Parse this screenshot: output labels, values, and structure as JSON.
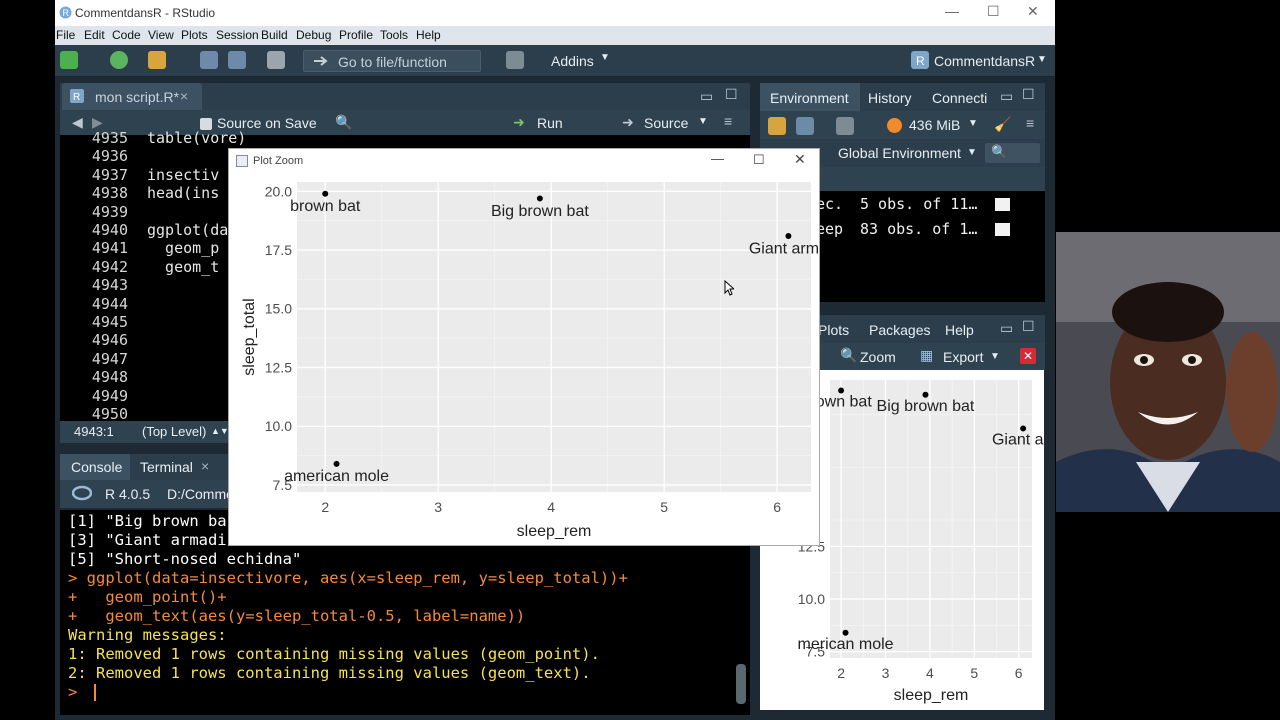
{
  "app": {
    "title": "CommentdansR - RStudio",
    "project": "CommentdansR"
  },
  "menu": [
    "File",
    "Edit",
    "Code",
    "View",
    "Plots",
    "Session",
    "Build",
    "Debug",
    "Profile",
    "Tools",
    "Help"
  ],
  "toolbar": {
    "goto_placeholder": "Go to file/function",
    "addins": "Addins"
  },
  "editor": {
    "tab_label": "mon script.R*",
    "source_on_save": "Source on Save",
    "run_label": "Run",
    "source_label": "Source",
    "line_numbers": [
      "4935",
      "4936",
      "4937",
      "4938",
      "4939",
      "4940",
      "4941",
      "4942",
      "4943",
      "4944",
      "4945",
      "4946",
      "4947",
      "4948",
      "4949",
      "4950"
    ],
    "code_lines": [
      "table(vore)",
      "",
      "insectiv",
      "head(ins",
      "",
      "ggplot(da",
      "  geom_p",
      "  geom_t",
      "",
      "",
      "",
      "",
      "",
      "",
      "",
      ""
    ],
    "status_position": "4943:1",
    "status_scope": "(Top Level)"
  },
  "environment": {
    "tabs": [
      "Environment",
      "History",
      "Connecti"
    ],
    "memory": "436 MiB",
    "scope": "Global Environment",
    "rows": [
      {
        "name": "ec.",
        "value": "5 obs. of 11…"
      },
      {
        "name": "eep",
        "value": "83 obs. of 1…"
      }
    ]
  },
  "files": {
    "tabs": [
      "Plots",
      "Packages",
      "Help"
    ],
    "zoom_label": "Zoom",
    "export_label": "Export"
  },
  "console": {
    "tabs": [
      "Console",
      "Terminal"
    ],
    "r_version": "R 4.0.5",
    "path": "D:/Comme",
    "lines": [
      {
        "text": "[1] \"Big brown ba",
        "color": "#ffffff"
      },
      {
        "text": "[3] \"Giant armadi",
        "color": "#ffffff"
      },
      {
        "text": "[5] \"Short-nosed echidna\"",
        "color": "#ffffff"
      },
      {
        "text": "> ggplot(data=insectivore, aes(x=sleep_rem, y=sleep_total))+",
        "color": "#f58a3c"
      },
      {
        "text": "+   geom_point()+",
        "color": "#f58a3c"
      },
      {
        "text": "+   geom_text(aes(y=sleep_total-0.5, label=name))",
        "color": "#f58a3c"
      },
      {
        "text": "Warning messages:",
        "color": "#f4e257"
      },
      {
        "text": "1: Removed 1 rows containing missing values (geom_point).",
        "color": "#f4e257"
      },
      {
        "text": "2: Removed 1 rows containing missing values (geom_text).",
        "color": "#f4e257"
      },
      {
        "text": "> ",
        "color": "#f58a3c"
      }
    ]
  },
  "plot_zoom_title": "Plot Zoom",
  "chart_data": [
    {
      "type": "scatter",
      "xlabel": "sleep_rem",
      "ylabel": "sleep_total",
      "x_ticks": [
        2,
        3,
        4,
        5,
        6
      ],
      "y_ticks": [
        "7.5",
        "10.0",
        "12.5",
        "15.0",
        "17.5",
        "20.0"
      ],
      "xlim": [
        1.75,
        6.3
      ],
      "ylim": [
        7.2,
        20.4
      ],
      "points": [
        {
          "x": 2.0,
          "y": 19.9,
          "label": "brown bat"
        },
        {
          "x": 3.9,
          "y": 19.7,
          "label": "Big brown bat"
        },
        {
          "x": 6.1,
          "y": 18.1,
          "label": "Giant arma"
        },
        {
          "x": 2.1,
          "y": 8.4,
          "label": "american mole"
        }
      ]
    },
    {
      "type": "scatter",
      "xlabel": "sleep_rem",
      "ylabel": "s",
      "x_ticks": [
        2,
        3,
        4,
        5,
        6
      ],
      "y_ticks": [
        "7.5",
        "10.0",
        "12.5"
      ],
      "xlim": [
        1.75,
        6.3
      ],
      "ylim": [
        7.2,
        20.4
      ],
      "points": [
        {
          "x": 2.0,
          "y": 19.9,
          "label": "rown bat"
        },
        {
          "x": 3.9,
          "y": 19.7,
          "label": "Big brown bat"
        },
        {
          "x": 6.1,
          "y": 18.1,
          "label": "Giant arr"
        },
        {
          "x": 2.1,
          "y": 8.4,
          "label": "merican mole"
        }
      ]
    }
  ]
}
